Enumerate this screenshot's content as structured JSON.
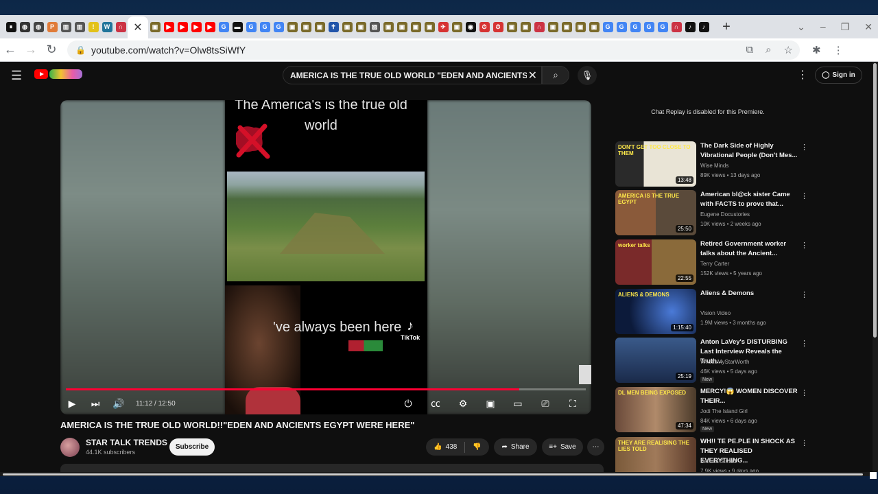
{
  "browser": {
    "tabs": [
      {
        "icon": "pause-icon",
        "color": "#111111",
        "glyph": "⏸"
      },
      {
        "icon": "globe-icon",
        "color": "#333333",
        "glyph": "◍"
      },
      {
        "icon": "globe-icon",
        "color": "#444444",
        "glyph": "◍"
      },
      {
        "icon": "procon-icon",
        "color": "#e07b39",
        "glyph": "P"
      },
      {
        "icon": "archive-icon",
        "color": "#555555",
        "glyph": "▥"
      },
      {
        "icon": "archive-icon",
        "color": "#555555",
        "glyph": "▥"
      },
      {
        "icon": "alert-icon",
        "color": "#e3c21a",
        "glyph": "!"
      },
      {
        "icon": "wordpress-icon",
        "color": "#21759b",
        "glyph": "W"
      },
      {
        "icon": "horseshoe-icon",
        "color": "#cc3344",
        "glyph": "∩"
      },
      {
        "icon": "video-tab-icon",
        "color": "#7a6a2a",
        "glyph": "▣"
      },
      {
        "icon": "youtube-icon",
        "color": "#ff0000",
        "glyph": "▶"
      },
      {
        "icon": "youtube-icon",
        "color": "#ff0000",
        "glyph": "▶"
      },
      {
        "icon": "youtube-icon",
        "color": "#ff0000",
        "glyph": "▶"
      },
      {
        "icon": "youtube-icon",
        "color": "#ff0000",
        "glyph": "▶"
      },
      {
        "icon": "google-icon",
        "color": "#4285f4",
        "glyph": "G"
      },
      {
        "icon": "dark-tab-icon",
        "color": "#111111",
        "glyph": "▬"
      },
      {
        "icon": "google-icon",
        "color": "#4285f4",
        "glyph": "G"
      },
      {
        "icon": "google-icon",
        "color": "#4285f4",
        "glyph": "G"
      },
      {
        "icon": "google-icon",
        "color": "#4285f4",
        "glyph": "G"
      },
      {
        "icon": "video-tab-icon",
        "color": "#7a6a2a",
        "glyph": "▣"
      },
      {
        "icon": "video-tab-icon",
        "color": "#7a6a2a",
        "glyph": "▣"
      },
      {
        "icon": "video-tab-icon",
        "color": "#7a6a2a",
        "glyph": "▣"
      },
      {
        "icon": "cross-icon",
        "color": "#2255aa",
        "glyph": "✝"
      },
      {
        "icon": "video-tab-icon",
        "color": "#7a6a2a",
        "glyph": "▣"
      },
      {
        "icon": "video-tab-icon",
        "color": "#7a6a2a",
        "glyph": "▣"
      },
      {
        "icon": "image-icon",
        "color": "#555555",
        "glyph": "▨"
      },
      {
        "icon": "video-tab-icon",
        "color": "#7a6a2a",
        "glyph": "▣"
      },
      {
        "icon": "video-tab-icon",
        "color": "#7a6a2a",
        "glyph": "▣"
      },
      {
        "icon": "video-tab-icon",
        "color": "#7a6a2a",
        "glyph": "▣"
      },
      {
        "icon": "video-tab-icon",
        "color": "#7a6a2a",
        "glyph": "▣"
      },
      {
        "icon": "flag-icon",
        "color": "#d63333",
        "glyph": "✈"
      },
      {
        "icon": "video-tab-icon",
        "color": "#7a6a2a",
        "glyph": "▣"
      },
      {
        "icon": "media-icon",
        "color": "#111111",
        "glyph": "◉"
      },
      {
        "icon": "timer-icon",
        "color": "#d63333",
        "glyph": "⏱"
      },
      {
        "icon": "timer-icon",
        "color": "#d63333",
        "glyph": "⏱"
      },
      {
        "icon": "video-tab-icon",
        "color": "#7a6a2a",
        "glyph": "▣"
      },
      {
        "icon": "video-tab-icon",
        "color": "#7a6a2a",
        "glyph": "▣"
      },
      {
        "icon": "horseshoe-icon",
        "color": "#cc3344",
        "glyph": "∩"
      },
      {
        "icon": "video-tab-icon",
        "color": "#7a6a2a",
        "glyph": "▣"
      },
      {
        "icon": "video-tab-icon",
        "color": "#7a6a2a",
        "glyph": "▣"
      },
      {
        "icon": "video-tab-icon",
        "color": "#7a6a2a",
        "glyph": "▣"
      },
      {
        "icon": "video-tab-icon",
        "color": "#7a6a2a",
        "glyph": "▣"
      },
      {
        "icon": "google-icon",
        "color": "#4285f4",
        "glyph": "G"
      },
      {
        "icon": "google-icon",
        "color": "#4285f4",
        "glyph": "G"
      },
      {
        "icon": "google-icon",
        "color": "#4285f4",
        "glyph": "G"
      },
      {
        "icon": "google-icon",
        "color": "#4285f4",
        "glyph": "G"
      },
      {
        "icon": "google-icon",
        "color": "#4285f4",
        "glyph": "G"
      },
      {
        "icon": "horseshoe-icon",
        "color": "#cc3344",
        "glyph": "∩"
      },
      {
        "icon": "tiktok-icon",
        "color": "#111111",
        "glyph": "♪"
      },
      {
        "icon": "tiktok-icon",
        "color": "#111111",
        "glyph": "♪"
      }
    ],
    "url": "youtube.com/watch?v=Olw8tsSiWfY"
  },
  "youtube": {
    "search_query": "AMERICA IS THE TRUE OLD WORLD \"EDEN AND ANCIENTS EGYPT W",
    "sign_in": "Sign in",
    "video": {
      "overlay_top": "The America's is the true old world",
      "overlay_bottom": "'ve always been here",
      "tiktok_label": "TikTok",
      "time": "11:12 / 12:50",
      "progress": 0.8714,
      "progress_color": "#ff0033"
    },
    "title": "AMERICA IS THE TRUE OLD WORLD!!\"EDEN AND ANCIENTS EGYPT WERE HERE\"",
    "channel": {
      "name": "STAR TALK TRENDS",
      "subscribers": "44.1K subscribers"
    },
    "subscribe": "Subscribe",
    "likes": "438",
    "share": "Share",
    "save": "Save",
    "chat_replay": "Chat Replay is disabled for this Premiere.",
    "recommendations": [
      {
        "title": "The Dark Side of Highly Vibrational People (Don't Mes...",
        "channel": "Wise Minds",
        "meta": "89K views • 13 days ago",
        "duration": "13:48",
        "thumb_text": "DON'T GET TOO CLOSE TO THEM",
        "badge": "",
        "thumb_bg": "linear-gradient(90deg,#2a2a2a 0 35%,#e9e4d6 35% 100%)"
      },
      {
        "title": "American bl@ck sister Came with FACTS to prove that...",
        "channel": "Eugene Docustories",
        "meta": "10K views • 2 weeks ago",
        "duration": "25:50",
        "thumb_text": "AMERICA IS THE TRUE EGYPT",
        "badge": "",
        "thumb_bg": "linear-gradient(90deg,#8a5a3a 0 50%,#5a4a3a 50% 100%)"
      },
      {
        "title": "Retired Government worker talks about the Ancient...",
        "channel": "Terry Carter",
        "meta": "152K views • 5 years ago",
        "duration": "22:55",
        "thumb_text": "worker talks",
        "badge": "",
        "thumb_bg": "linear-gradient(90deg,#7a2a2a 0 45%,#8a6a3a 45% 100%)"
      },
      {
        "title": "Aliens & Demons",
        "channel": "Vision Video",
        "meta": "1.9M views • 3 months ago",
        "duration": "1:15:40",
        "thumb_text": "ALIENS & DEMONS",
        "badge": "",
        "thumb_bg": "radial-gradient(circle at 70% 50%,#4a7ad8,#0c1a3a 70%)"
      },
      {
        "title": "Anton LaVey's DISTURBING Last Interview Reveals the Truth...",
        "channel": "WhatIsMyStarWorth",
        "meta": "46K views • 5 days ago",
        "duration": "25:19",
        "thumb_text": "",
        "badge": "New",
        "thumb_bg": "linear-gradient(180deg,#3a5a8a,#1a2a4a)"
      },
      {
        "title": "MERCY!😱 WOMEN DISCOVER THEIR...",
        "channel": "Jodi The Island Girl",
        "meta": "84K views • 6 days ago",
        "duration": "47:34",
        "thumb_text": "DL MEN BEING EXPOSED",
        "badge": "New",
        "thumb_bg": "linear-gradient(90deg,#6a4a3a,#b08a6a,#4a3a2a)"
      },
      {
        "title": "WH!! TE PE.PLE IN SHOCK AS THEY REALISED EVERYTHING...",
        "channel": "Belinda Strnad",
        "meta": "7.9K views • 9 days ago",
        "duration": "",
        "thumb_text": "THEY ARE REALISING THE LIES TOLD",
        "badge": "",
        "thumb_bg": "linear-gradient(90deg,#7a5a3a,#a07a5a,#5a3a2a)"
      }
    ]
  }
}
